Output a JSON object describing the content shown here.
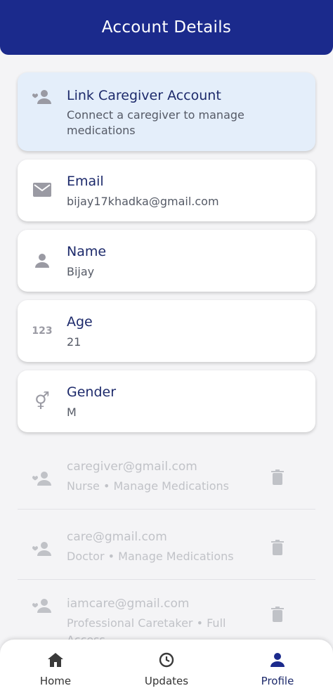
{
  "header": {
    "title": "Account Details"
  },
  "cards": [
    {
      "id": "link",
      "icon": "add-person-icon",
      "title": "Link Caregiver Account",
      "subtitle": "Connect a caregiver to manage medications"
    },
    {
      "id": "email",
      "icon": "mail-icon",
      "title": "Email",
      "subtitle": "bijay17khadka@gmail.com"
    },
    {
      "id": "name",
      "icon": "person-icon",
      "title": "Name",
      "subtitle": "Bijay"
    },
    {
      "id": "age",
      "icon": "numbers-icon",
      "title": "Age",
      "subtitle": "21",
      "icon_text": "123"
    },
    {
      "id": "gender",
      "icon": "gender-icon",
      "title": "Gender",
      "subtitle": "M",
      "icon_text": "⚥"
    }
  ],
  "caregivers": [
    {
      "email": "caregiver@gmail.com",
      "role": "Nurse • Manage Medications"
    },
    {
      "email": "care@gmail.com",
      "role": "Doctor • Manage Medications"
    },
    {
      "email": "iamcare@gmail.com",
      "role": "Professional Caretaker • Full Access"
    }
  ],
  "nav": {
    "items": [
      {
        "label": "Home",
        "icon": "home-icon"
      },
      {
        "label": "Updates",
        "icon": "history-icon"
      },
      {
        "label": "Profile",
        "icon": "profile-icon",
        "active": true
      }
    ]
  },
  "colors": {
    "primary": "#1b2a8c",
    "highlight": "#e4eefa",
    "icon_gray": "#9a9aa3"
  }
}
